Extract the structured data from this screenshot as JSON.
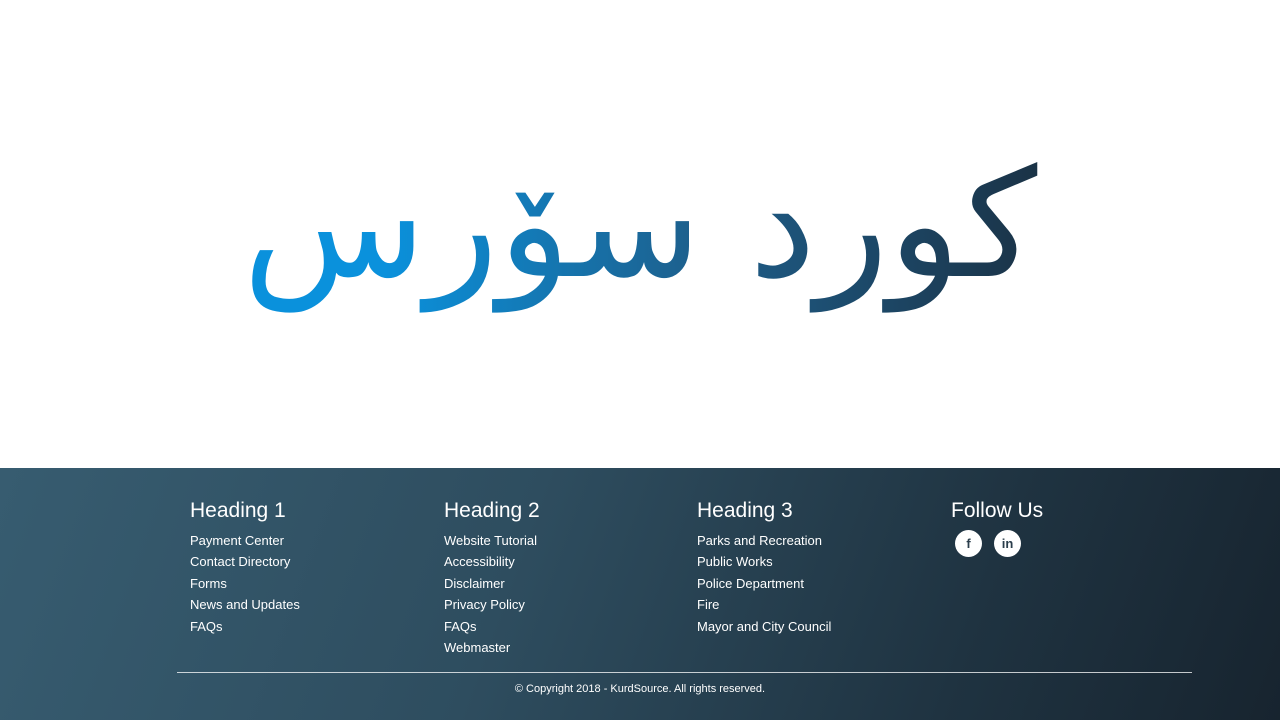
{
  "hero": {
    "logo_text": "كورد سۆرس"
  },
  "footer": {
    "columns": [
      {
        "heading": "Heading 1",
        "links": [
          "Payment Center",
          "Contact Directory",
          "Forms",
          "News and Updates",
          "FAQs"
        ]
      },
      {
        "heading": "Heading 2",
        "links": [
          "Website Tutorial",
          "Accessibility",
          "Disclaimer",
          "Privacy Policy",
          "FAQs",
          "Webmaster"
        ]
      },
      {
        "heading": "Heading 3",
        "links": [
          "Parks and Recreation",
          "Public Works",
          "Police Department",
          "Fire",
          "Mayor and City Council"
        ]
      }
    ],
    "follow": {
      "heading": "Follow Us",
      "icons": [
        {
          "name": "facebook-icon",
          "glyph": "f"
        },
        {
          "name": "linkedin-icon",
          "glyph": "in"
        }
      ]
    },
    "copyright": "© Copyright 2018 - KurdSource. All rights reserved."
  },
  "colors": {
    "logo_gradient_start": "#0a91dc",
    "logo_gradient_end": "#1a2c3c",
    "footer_gradient_start": "#375c70",
    "footer_gradient_end": "#17242f"
  }
}
